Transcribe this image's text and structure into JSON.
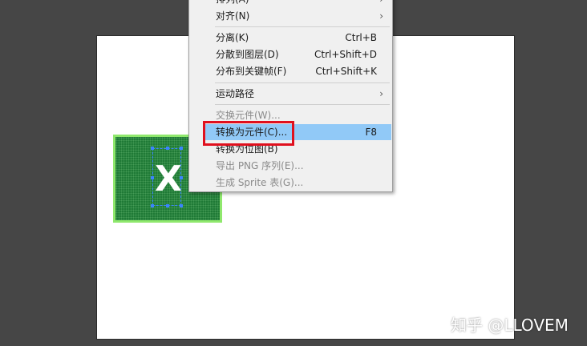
{
  "menu": {
    "items": [
      {
        "label": "排列(A)",
        "shortcut": "",
        "submenu": true,
        "disabled": false,
        "highlight": false
      },
      {
        "label": "对齐(N)",
        "shortcut": "",
        "submenu": true,
        "disabled": false,
        "highlight": false
      },
      {
        "label": "分离(K)",
        "shortcut": "Ctrl+B",
        "submenu": false,
        "disabled": false,
        "highlight": false
      },
      {
        "label": "分散到图层(D)",
        "shortcut": "Ctrl+Shift+D",
        "submenu": false,
        "disabled": false,
        "highlight": false
      },
      {
        "label": "分布到关键帧(F)",
        "shortcut": "Ctrl+Shift+K",
        "submenu": false,
        "disabled": false,
        "highlight": false
      },
      {
        "label": "运动路径",
        "shortcut": "",
        "submenu": true,
        "disabled": false,
        "highlight": false
      },
      {
        "label": "交换元件(W)...",
        "shortcut": "",
        "submenu": false,
        "disabled": true,
        "highlight": false
      },
      {
        "label": "转换为元件(C)...",
        "shortcut": "F8",
        "submenu": false,
        "disabled": false,
        "highlight": true
      },
      {
        "label": "转换为位图(B)",
        "shortcut": "",
        "submenu": false,
        "disabled": false,
        "highlight": false
      },
      {
        "label": "导出 PNG 序列(E)...",
        "shortcut": "",
        "submenu": false,
        "disabled": true,
        "highlight": false
      },
      {
        "label": "生成 Sprite 表(G)...",
        "shortcut": "",
        "submenu": false,
        "disabled": true,
        "highlight": false
      }
    ],
    "submenu_arrow": "›"
  },
  "symbol": {
    "letter": "X",
    "fill_color": "#1f7a36",
    "outline_color": "#8fe86d"
  },
  "watermark": "知乎 @LLOVEM",
  "colors": {
    "highlight": "#91c9f7",
    "annotation_red": "#e0101e",
    "background": "#464646"
  }
}
